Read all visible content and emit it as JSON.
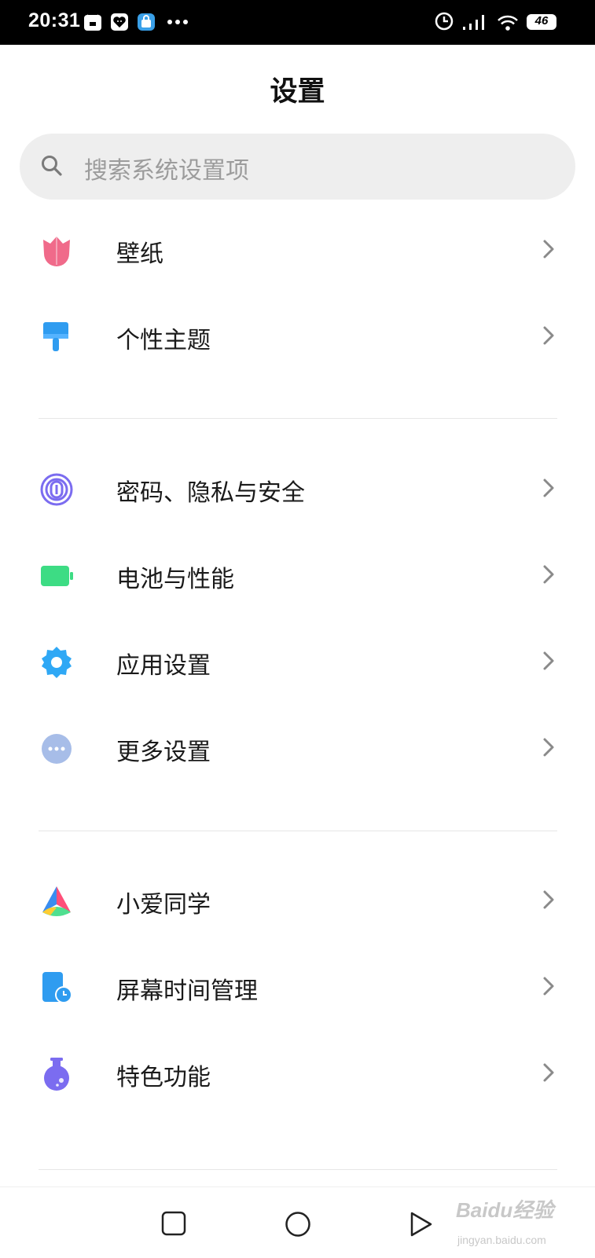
{
  "status_bar": {
    "time": "20:31",
    "battery_level": "46",
    "notification_icons": [
      "mi-notify-icon",
      "heart-app-icon",
      "store-bag-icon",
      "more-dots-icon"
    ],
    "system_icons": [
      "alarm-clock-icon",
      "signal-icon",
      "wifi-icon",
      "battery-icon"
    ]
  },
  "header": {
    "title": "设置"
  },
  "search": {
    "placeholder": "搜索系统设置项"
  },
  "groups": [
    {
      "items": [
        {
          "label": "壁纸",
          "icon": "tulip-wallpaper-icon",
          "color": "#f06a8a"
        },
        {
          "label": "个性主题",
          "icon": "paintbrush-theme-icon",
          "color": "#2f9cf0"
        }
      ]
    },
    {
      "items": [
        {
          "label": "密码、隐私与安全",
          "icon": "fingerprint-icon",
          "color": "#7b6cf0"
        },
        {
          "label": "电池与性能",
          "icon": "battery-icon",
          "color": "#3ddc84"
        },
        {
          "label": "应用设置",
          "icon": "gear-icon",
          "color": "#2fa8f5"
        },
        {
          "label": "更多设置",
          "icon": "more-dots-circle-icon",
          "color": "#9db6e8"
        }
      ]
    },
    {
      "items": [
        {
          "label": "小爱同学",
          "icon": "xiaoai-assistant-icon",
          "color": "#ff5a7a"
        },
        {
          "label": "屏幕时间管理",
          "icon": "screen-time-icon",
          "color": "#2f9cf0"
        },
        {
          "label": "特色功能",
          "icon": "flask-icon",
          "color": "#7b6cf0"
        }
      ]
    }
  ],
  "navbar": {
    "buttons": [
      "recent-apps-square-icon",
      "home-circle-icon",
      "back-triangle-icon"
    ]
  },
  "watermark": {
    "text": "Baidu经验",
    "sub": "jingyan.baidu.com"
  }
}
